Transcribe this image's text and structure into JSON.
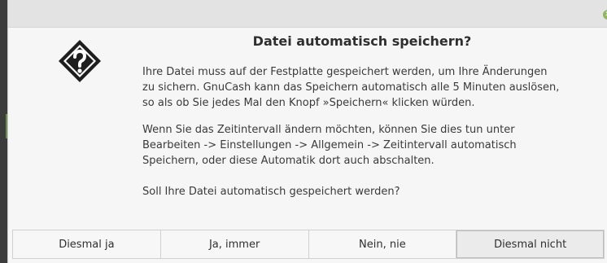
{
  "dialog": {
    "title": "Datei automatisch speichern?",
    "paragraphs": [
      "Ihre Datei muss auf der Festplatte gespeichert werden, um Ihre Änderungen\nzu sichern. GnuCash kann das Speichern automatisch alle 5 Minuten auslösen,\nso als ob Sie jedes Mal den Knopf »Speichern« klicken würden.",
      "Wenn Sie das Zeitintervall ändern möchten, können Sie dies tun unter\nBearbeiten -> Einstellungen -> Allgemein -> Zeitintervall automatisch\nSpeichern, oder diese Automatik dort auch abschalten.",
      "Soll Ihre Datei automatisch gespeichert werden?"
    ],
    "icon": "question-icon",
    "close_icon": "close-icon"
  },
  "buttons": {
    "once_yes": "Diesmal ja",
    "always_yes": "Ja, immer",
    "never": "Nein, nie",
    "once_no": "Diesmal nicht"
  },
  "colors": {
    "close_button": "#8fb563",
    "titlebar": "#e3e3e3",
    "dialog_bg": "#f6f6f6"
  }
}
